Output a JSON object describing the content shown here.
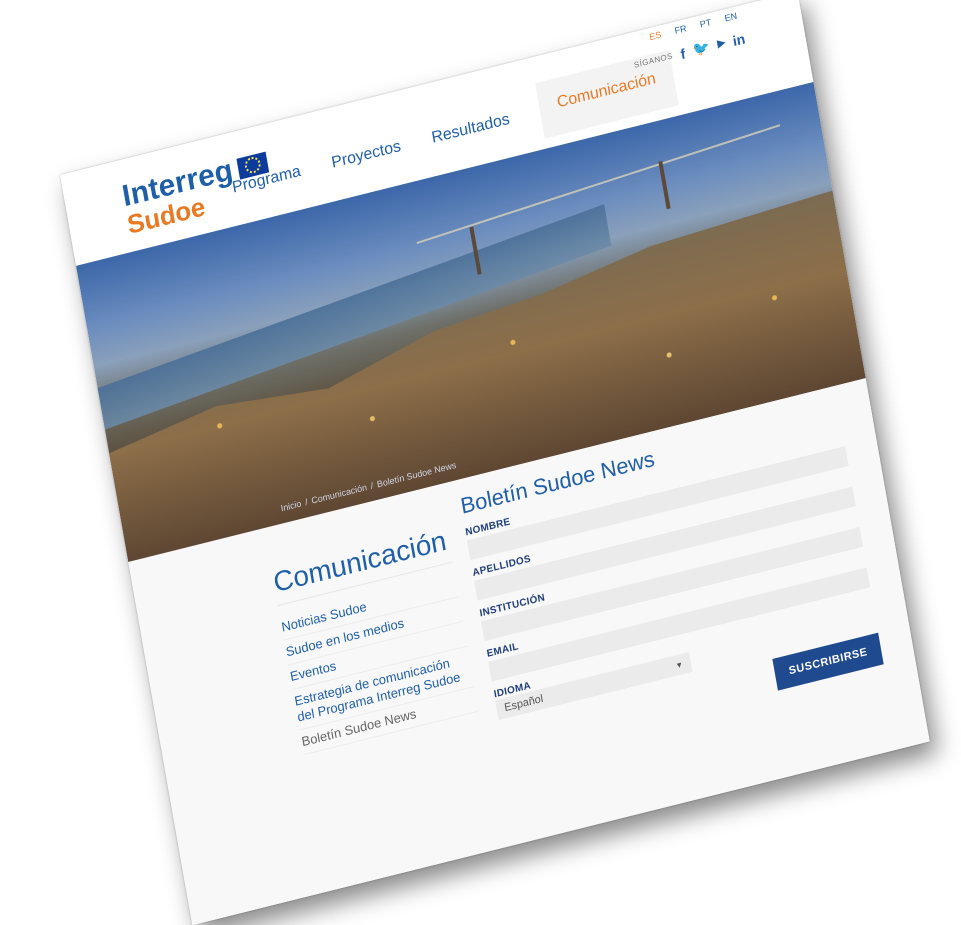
{
  "logo": {
    "line1": "Interreg",
    "line2": "Sudoe"
  },
  "nav": {
    "items": [
      {
        "label": "Programa"
      },
      {
        "label": "Proyectos"
      },
      {
        "label": "Resultados"
      },
      {
        "label": "Comunicación"
      }
    ],
    "active": "Comunicación"
  },
  "languages": [
    "ES",
    "FR",
    "PT",
    "EN"
  ],
  "current_language": "ES",
  "social": {
    "label": "SÍGANOS",
    "icons": [
      "facebook-icon",
      "twitter-icon",
      "youtube-icon",
      "linkedin-icon"
    ],
    "facebook": "f",
    "twitter": "t",
    "youtube": "You",
    "linkedin": "in"
  },
  "breadcrumb": {
    "home": "Inicio",
    "sep": "/",
    "section": "Comunicación",
    "page": "Boletín Sudoe News"
  },
  "sidebar": {
    "title": "Comunicación",
    "items": [
      {
        "label": "Noticias Sudoe"
      },
      {
        "label": "Sudoe en los medios"
      },
      {
        "label": "Eventos"
      },
      {
        "label": "Estrategia de comunicación del Programa Interreg Sudoe"
      },
      {
        "label": "Boletín Sudoe News"
      }
    ]
  },
  "form": {
    "title": "Boletín Sudoe News",
    "fields": {
      "nombre": "NOMBRE",
      "apellidos": "APELLIDOS",
      "institucion": "INSTITUCIÓN",
      "email": "EMAIL",
      "idioma": "IDIOMA"
    },
    "idioma_value": "Español",
    "submit": "SUSCRIBIRSE"
  },
  "colors": {
    "brand_blue": "#1f5fa8",
    "brand_orange": "#e87a24",
    "button_blue": "#1f4a8f"
  }
}
